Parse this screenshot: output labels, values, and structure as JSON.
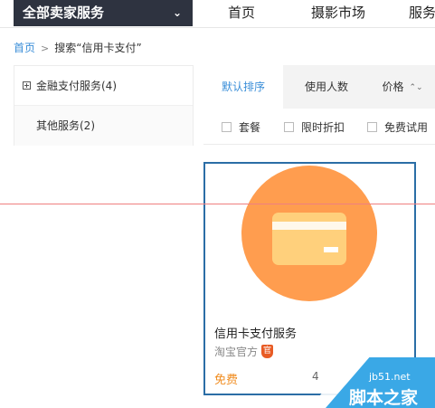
{
  "topnav": {
    "category_button": "全部卖家服务",
    "items": [
      "首页",
      "摄影市场",
      "服务"
    ]
  },
  "breadcrumb": {
    "home": "首页",
    "search": "搜索“信用卡支付”"
  },
  "sidebar": {
    "items": [
      {
        "label": "金融支付服务(4)"
      },
      {
        "label": "其他服务(2)"
      }
    ]
  },
  "sort": {
    "tabs": [
      "默认排序",
      "使用人数",
      "价格"
    ]
  },
  "filters": [
    "套餐",
    "限时折扣",
    "免费试用"
  ],
  "card": {
    "title": "信用卡支付服务",
    "seller": "淘宝官方",
    "badge": "官",
    "price": "免费",
    "count": "4"
  },
  "watermark": {
    "url": "jb51.net",
    "text": "脚本之家"
  },
  "colors": {
    "accent": "#3a8ed8",
    "dark_nav": "#2e3340",
    "card_border": "#2b6ea6",
    "circle": "#ff9d4f",
    "price": "#f08c1f"
  }
}
